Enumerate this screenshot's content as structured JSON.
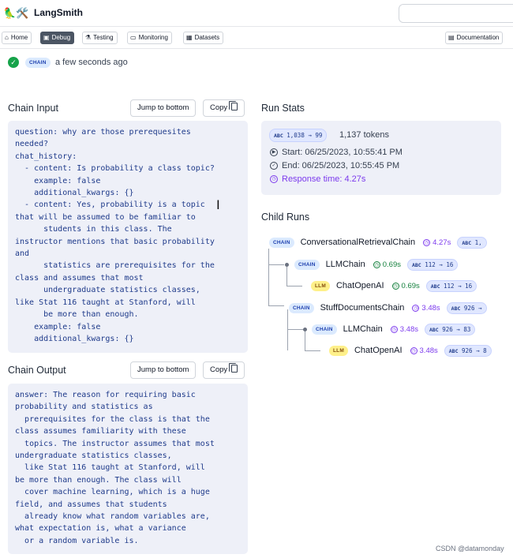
{
  "header": {
    "logo": "🦜🛠️",
    "title": "LangSmith"
  },
  "nav": {
    "items": [
      {
        "icon": "⌂",
        "label": "Home"
      },
      {
        "icon": "▣",
        "label": "Debug"
      },
      {
        "icon": "⚗",
        "label": "Testing"
      },
      {
        "icon": "▭",
        "label": "Monitoring"
      },
      {
        "icon": "▦",
        "label": "Datasets"
      }
    ],
    "documentation": {
      "icon": "▤",
      "label": "Documentation"
    }
  },
  "status": {
    "badge": "CHAIN",
    "time": "a few seconds ago"
  },
  "chain_input": {
    "title": "Chain Input",
    "jump_label": "Jump to bottom",
    "copy_label": "Copy",
    "content": "question: why are those prerequesites\nneeded?\nchat_history:\n  - content: Is probability a class topic?\n    example: false\n    additional_kwargs: {}\n  - content: Yes, probability is a topic\nthat will be assumed to be familiar to\n      students in this class. The\ninstructor mentions that basic probability\nand\n      statistics are prerequisites for the\nclass and assumes that most\n      undergraduate statistics classes,\nlike Stat 116 taught at Stanford, will\n      be more than enough.\n    example: false\n    additional_kwargs: {}"
  },
  "chain_output": {
    "title": "Chain Output",
    "jump_label": "Jump to bottom",
    "copy_label": "Copy",
    "content": "answer: The reason for requiring basic\nprobability and statistics as\n  prerequisites for the class is that the\nclass assumes familiarity with these\n  topics. The instructor assumes that most\nundergraduate statistics classes,\n  like Stat 116 taught at Stanford, will\nbe more than enough. The class will\n  cover machine learning, which is a huge\nfield, and assumes that students\n  already know what random variables are,\nwhat expectation is, what a variance\n  or a random variable is."
  },
  "run_stats": {
    "title": "Run Stats",
    "tokens_abc": "ABC",
    "tokens_pill": "1,038 → 99",
    "tokens_total": "1,137 tokens",
    "start": "Start: 06/25/2023, 10:55:41 PM",
    "end": "End: 06/25/2023, 10:55:45 PM",
    "response_time": "Response time: 4.27s"
  },
  "child_runs": {
    "title": "Child Runs",
    "runs": [
      {
        "type": "CHAIN",
        "name": "ConversationalRetrievalChain",
        "time": "4.27s",
        "tokens": "1,"
      },
      {
        "type": "CHAIN",
        "name": "LLMChain",
        "time": "0.69s",
        "tokens": "112 → 16"
      },
      {
        "type": "LLM",
        "name": "ChatOpenAI",
        "time": "0.69s",
        "tokens": "112 → 16"
      },
      {
        "type": "CHAIN",
        "name": "StuffDocumentsChain",
        "time": "3.48s",
        "tokens": "926 →"
      },
      {
        "type": "CHAIN",
        "name": "LLMChain",
        "time": "3.48s",
        "tokens": "926 → 83"
      },
      {
        "type": "LLM",
        "name": "ChatOpenAI",
        "time": "3.48s",
        "tokens": "926 → 8"
      }
    ],
    "abc": "ABC"
  },
  "watermark": "CSDN @datamonday",
  "colors": {
    "accent": "#7c3aed",
    "success": "#16a34a",
    "code_bg": "#eef0f8",
    "code_text": "#1e3a8a"
  }
}
